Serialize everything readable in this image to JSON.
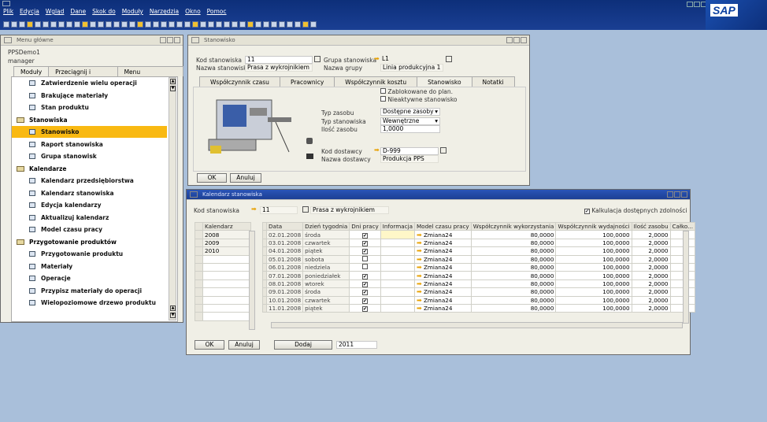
{
  "menubar": [
    "Plik",
    "Edycja",
    "Wgląd",
    "Dane",
    "Skok do",
    "Moduły",
    "Narzędzia",
    "Okno",
    "Pomoc"
  ],
  "logo": "SAP",
  "mainmenu": {
    "title": "Menu główne",
    "company": "PPSDemo1",
    "user": "manager",
    "tabs": [
      "Moduły",
      "Przeciągnij i skojarz",
      "Menu użytkownika"
    ],
    "items": [
      {
        "type": "doc",
        "label": "Zatwierdzenie wielu operacji"
      },
      {
        "type": "doc",
        "label": "Brakujące materiały"
      },
      {
        "type": "doc",
        "label": "Stan produktu"
      },
      {
        "type": "folder",
        "label": "Stanowiska"
      },
      {
        "type": "doc",
        "label": "Stanowisko",
        "selected": true
      },
      {
        "type": "doc",
        "label": "Raport stanowiska"
      },
      {
        "type": "doc",
        "label": "Grupa stanowisk"
      },
      {
        "type": "folder",
        "label": "Kalendarze"
      },
      {
        "type": "doc",
        "label": "Kalendarz przedsiębiorstwa"
      },
      {
        "type": "doc",
        "label": "Kalendarz stanowiska"
      },
      {
        "type": "doc",
        "label": "Edycja kalendarzy"
      },
      {
        "type": "doc",
        "label": "Aktualizuj kalendarz"
      },
      {
        "type": "doc",
        "label": "Model czasu pracy"
      },
      {
        "type": "folder",
        "label": "Przygotowanie produktów"
      },
      {
        "type": "doc",
        "label": "Przygotowanie produktu"
      },
      {
        "type": "doc",
        "label": "Materiały"
      },
      {
        "type": "doc",
        "label": "Operacje"
      },
      {
        "type": "doc",
        "label": "Przypisz materiały do operacji"
      },
      {
        "type": "doc",
        "label": "Wielopoziomowe drzewo produktu"
      }
    ]
  },
  "stanowisko": {
    "title": "Stanowisko",
    "kod_label": "Kod stanowiska",
    "kod_value": "11",
    "nazwa_label": "Nazwa stanowiska",
    "nazwa_value": "Prasa z wykrojnikiem",
    "grupa_label": "Grupa stanowiska",
    "grupa_value": "L1",
    "nazwa_grupy_label": "Nazwa grupy",
    "nazwa_grupy_value": "Linia produkcyjna 1",
    "tabs": [
      "Współczynnik czasu",
      "Pracownicy",
      "Współczynnik kosztu",
      "Stanowisko",
      "Notatki"
    ],
    "zablokowane": "Zablokowane do plan.",
    "nieaktywne": "Nieaktywne stanowisko",
    "typ_zasobu_label": "Typ zasobu",
    "typ_zasobu_value": "Dostępne zasoby",
    "typ_stanowiska_label": "Typ stanowiska",
    "typ_stanowiska_value": "Wewnętrzne",
    "ilosc_label": "Ilość zasobu",
    "ilosc_value": "1,0000",
    "kod_dostawcy_label": "Kod dostawcy",
    "kod_dostawcy_value": "D-999",
    "nazwa_dostawcy_label": "Nazwa dostawcy",
    "nazwa_dostawcy_value": "Produkcja PPS",
    "ok": "OK",
    "anuluj": "Anuluj"
  },
  "kalendarz": {
    "title": "Kalendarz stanowiska",
    "kod_label": "Kod stanowiska",
    "kod_value": "11",
    "nazwa_value": "Prasa z wykrojnikiem",
    "kalkulacja": "Kalkulacja dostępnych zdolności",
    "years_header": "Kalendarz",
    "years": [
      "2008",
      "2009",
      "2010"
    ],
    "columns": [
      "Data",
      "Dzień tygodnia",
      "Dni pracy",
      "Informacja",
      "Model czasu pracy",
      "Współczynnik wykorzystania",
      "Współczynnik wydajności",
      "Ilość zasobu",
      "Całko..."
    ],
    "rows": [
      {
        "data": "02.01.2008",
        "dzien": "środa",
        "pracy": true,
        "model": "Zmiana24",
        "wyk": "80,0000",
        "wyd": "100,0000",
        "il": "2,0000"
      },
      {
        "data": "03.01.2008",
        "dzien": "czwartek",
        "pracy": true,
        "model": "Zmiana24",
        "wyk": "80,0000",
        "wyd": "100,0000",
        "il": "2,0000"
      },
      {
        "data": "04.01.2008",
        "dzien": "piątek",
        "pracy": true,
        "model": "Zmiana24",
        "wyk": "80,0000",
        "wyd": "100,0000",
        "il": "2,0000"
      },
      {
        "data": "05.01.2008",
        "dzien": "sobota",
        "pracy": false,
        "model": "Zmiana24",
        "wyk": "80,0000",
        "wyd": "100,0000",
        "il": "2,0000"
      },
      {
        "data": "06.01.2008",
        "dzien": "niedziela",
        "pracy": false,
        "model": "Zmiana24",
        "wyk": "80,0000",
        "wyd": "100,0000",
        "il": "2,0000"
      },
      {
        "data": "07.01.2008",
        "dzien": "poniedziałek",
        "pracy": true,
        "model": "Zmiana24",
        "wyk": "80,0000",
        "wyd": "100,0000",
        "il": "2,0000"
      },
      {
        "data": "08.01.2008",
        "dzien": "wtorek",
        "pracy": true,
        "model": "Zmiana24",
        "wyk": "80,0000",
        "wyd": "100,0000",
        "il": "2,0000"
      },
      {
        "data": "09.01.2008",
        "dzien": "środa",
        "pracy": true,
        "model": "Zmiana24",
        "wyk": "80,0000",
        "wyd": "100,0000",
        "il": "2,0000"
      },
      {
        "data": "10.01.2008",
        "dzien": "czwartek",
        "pracy": true,
        "model": "Zmiana24",
        "wyk": "80,0000",
        "wyd": "100,0000",
        "il": "2,0000"
      },
      {
        "data": "11.01.2008",
        "dzien": "piątek",
        "pracy": true,
        "model": "Zmiana24",
        "wyk": "80,0000",
        "wyd": "100,0000",
        "il": "2,0000"
      }
    ],
    "ok": "OK",
    "anuluj": "Anuluj",
    "dodaj": "Dodaj",
    "year_input": "2011"
  }
}
